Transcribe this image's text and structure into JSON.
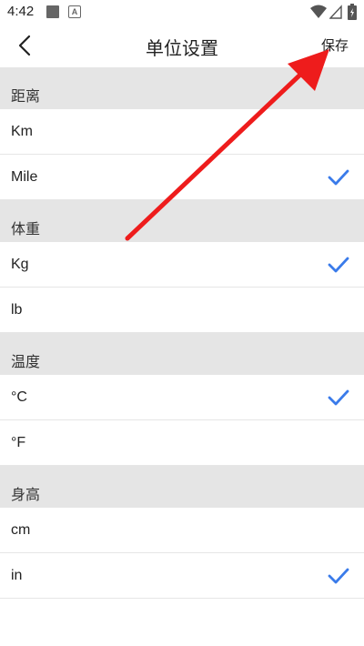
{
  "status_bar": {
    "time": "4:42",
    "icons": [
      "notification-square-icon",
      "app-a-icon",
      "wifi-icon",
      "signal-icon",
      "battery-icon"
    ]
  },
  "header": {
    "title": "单位设置",
    "save_label": "保存",
    "back_icon": "chevron-left-icon"
  },
  "sections": [
    {
      "title": "距离",
      "options": [
        {
          "label": "Km",
          "selected": false
        },
        {
          "label": "Mile",
          "selected": true
        }
      ]
    },
    {
      "title": "体重",
      "options": [
        {
          "label": "Kg",
          "selected": true
        },
        {
          "label": "lb",
          "selected": false
        }
      ]
    },
    {
      "title": "温度",
      "options": [
        {
          "label": "°C",
          "selected": true
        },
        {
          "label": "°F",
          "selected": false
        }
      ]
    },
    {
      "title": "身高",
      "options": [
        {
          "label": "cm",
          "selected": false
        },
        {
          "label": "in",
          "selected": true
        }
      ]
    }
  ],
  "colors": {
    "check": "#3a7bea",
    "section_bg": "#e5e5e5",
    "annotation_arrow": "#ee1c1c"
  }
}
